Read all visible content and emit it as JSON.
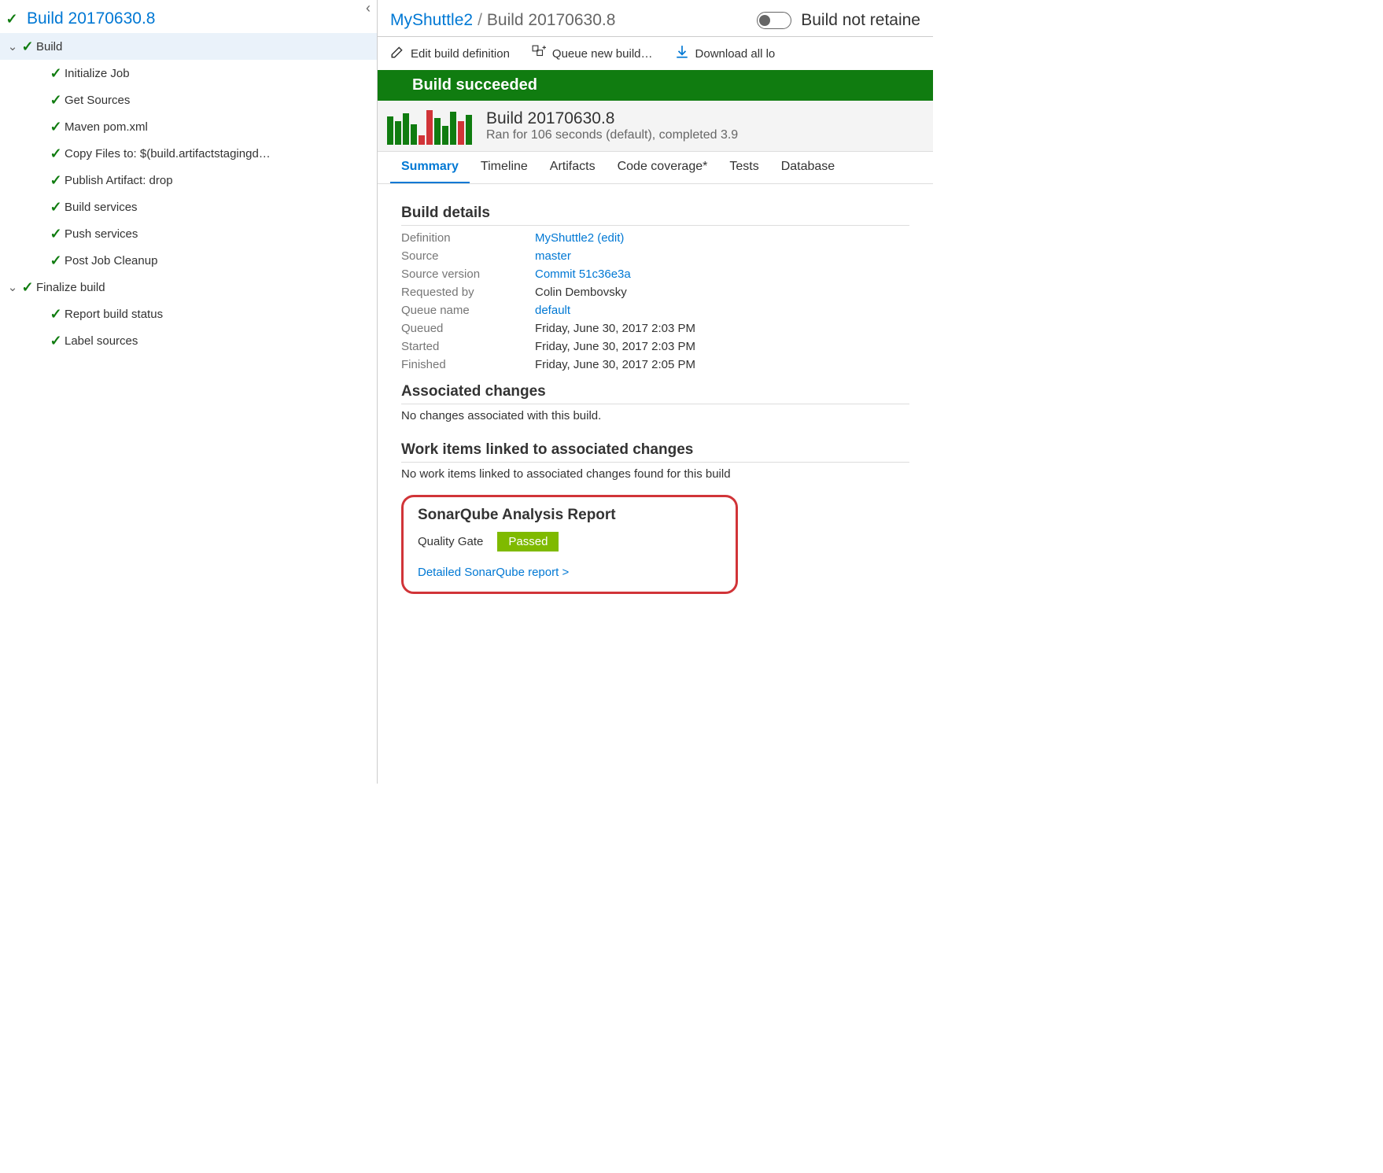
{
  "left": {
    "title": "Build 20170630.8",
    "groups": [
      {
        "label": "Build",
        "items": [
          "Initialize Job",
          "Get Sources",
          "Maven pom.xml",
          "Copy Files to: $(build.artifactstagingd…",
          "Publish Artifact: drop",
          "Build services",
          "Push services",
          "Post Job Cleanup"
        ]
      },
      {
        "label": "Finalize build",
        "items": [
          "Report build status",
          "Label sources"
        ]
      }
    ]
  },
  "breadcrumb": {
    "project": "MyShuttle2",
    "build": "Build 20170630.8",
    "retain": "Build not retaine"
  },
  "actions": {
    "edit": "Edit build definition",
    "queue": "Queue new build…",
    "download": "Download all lo"
  },
  "status_bar": "Build succeeded",
  "summary": {
    "title": "Build 20170630.8",
    "sub": "Ran for 106 seconds (default), completed 3.9 "
  },
  "tabs": [
    "Summary",
    "Timeline",
    "Artifacts",
    "Code coverage*",
    "Tests",
    "Database"
  ],
  "details": {
    "title": "Build details",
    "rows": [
      {
        "k": "Definition",
        "v": "MyShuttle2 (edit)",
        "link": true
      },
      {
        "k": "Source",
        "v": "master",
        "link": true
      },
      {
        "k": "Source version",
        "v": "Commit 51c36e3a",
        "link": true
      },
      {
        "k": "Requested by",
        "v": "Colin Dembovsky",
        "link": false
      },
      {
        "k": "Queue name",
        "v": "default",
        "link": true
      },
      {
        "k": "Queued",
        "v": "Friday, June 30, 2017 2:03 PM",
        "link": false
      },
      {
        "k": "Started",
        "v": "Friday, June 30, 2017 2:03 PM",
        "link": false
      },
      {
        "k": "Finished",
        "v": "Friday, June 30, 2017 2:05 PM",
        "link": false
      }
    ]
  },
  "changes": {
    "title": "Associated changes",
    "text": "No changes associated with this build."
  },
  "workitems": {
    "title": "Work items linked to associated changes",
    "text": "No work items linked to associated changes found for this build"
  },
  "sonar": {
    "title": "SonarQube Analysis Report",
    "qg_label": "Quality Gate",
    "qg_status": "Passed",
    "link": "Detailed SonarQube report >"
  },
  "histogram": [
    36,
    30,
    40,
    26,
    12,
    44,
    34,
    24,
    42,
    30,
    38
  ],
  "histogram_colors": [
    "g",
    "g",
    "g",
    "g",
    "r",
    "r",
    "g",
    "g",
    "g",
    "r",
    "g"
  ]
}
